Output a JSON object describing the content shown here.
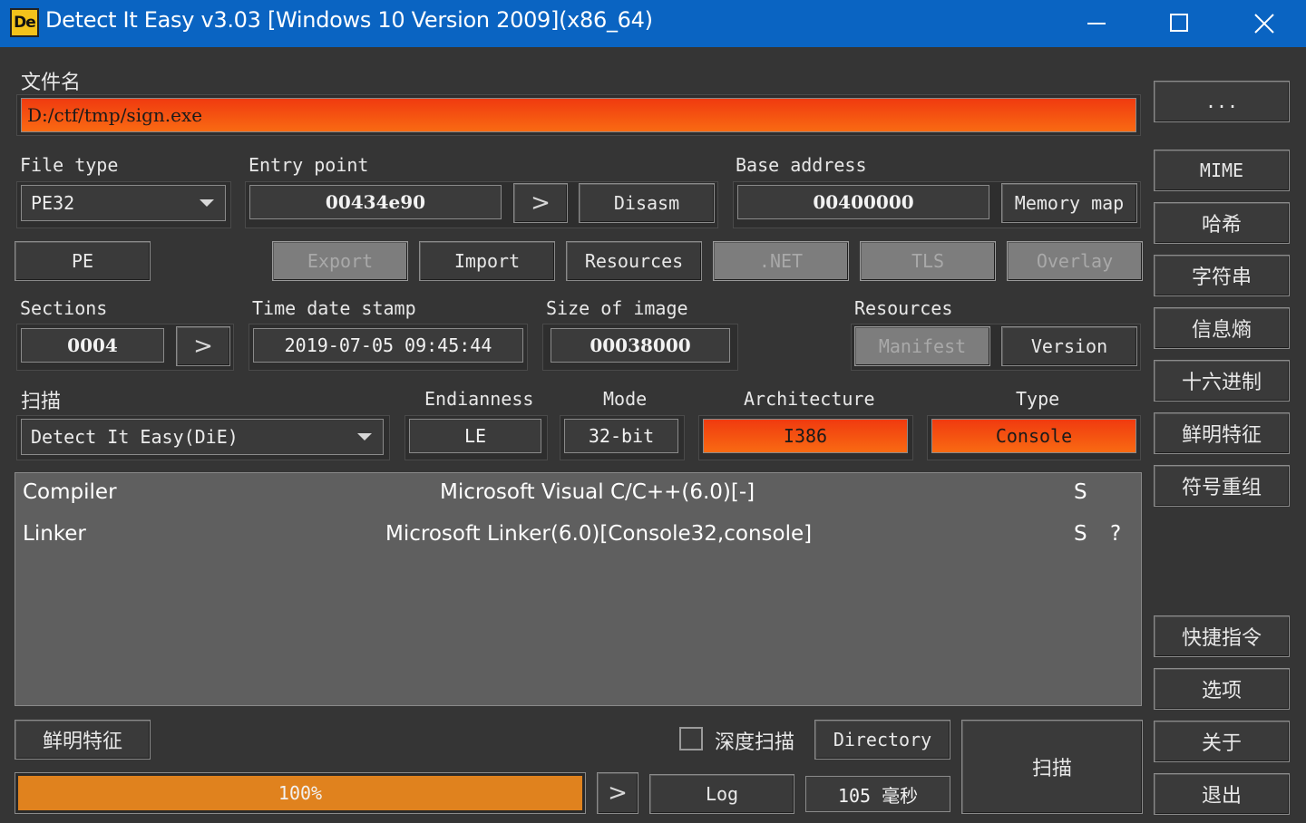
{
  "window": {
    "icon_text": "De",
    "title": "Detect It Easy v3.03 [Windows 10 Version 2009](x86_64)"
  },
  "file": {
    "label": "文件名",
    "path": "D:/ctf/tmp/sign.exe",
    "browse_label": "..."
  },
  "file_type": {
    "label": "File type",
    "value": "PE32"
  },
  "entry_point": {
    "label": "Entry point",
    "value": "00434e90",
    "go_label": ">",
    "disasm_label": "Disasm"
  },
  "base_address": {
    "label": "Base address",
    "value": "00400000",
    "memory_map_label": "Memory map"
  },
  "pe_buttons": {
    "pe": "PE",
    "export": "Export",
    "import": "Import",
    "resources": "Resources",
    "dotnet": ".NET",
    "tls": "TLS",
    "overlay": "Overlay"
  },
  "sections": {
    "label": "Sections",
    "value": "0004",
    "go_label": ">"
  },
  "time_date_stamp": {
    "label": "Time date stamp",
    "value": "2019-07-05 09:45:44"
  },
  "size_of_image": {
    "label": "Size of image",
    "value": "00038000"
  },
  "resources": {
    "label": "Resources",
    "manifest_label": "Manifest",
    "version_label": "Version"
  },
  "scan": {
    "label": "扫描",
    "engine": "Detect It Easy(DiE)",
    "endianness_label": "Endianness",
    "endianness": "LE",
    "mode_label": "Mode",
    "mode": "32-bit",
    "architecture_label": "Architecture",
    "architecture": "I386",
    "type_label": "Type",
    "type": "Console"
  },
  "results": [
    {
      "kind": "Compiler",
      "name": "Microsoft Visual C/C++(6.0)[-]",
      "flag": "S",
      "extra": ""
    },
    {
      "kind": "Linker",
      "name": "Microsoft Linker(6.0)[Console32,console]",
      "flag": "S",
      "extra": "?"
    }
  ],
  "bottom": {
    "signatures_label": "鲜明特征",
    "deep_scan_label": "深度扫描",
    "deep_scan_checked": false,
    "directory_label": "Directory",
    "scan_label": "扫描",
    "progress_text": "100%",
    "progress_value": 1.0,
    "go_label": ">",
    "log_label": "Log",
    "elapsed": "105 毫秒"
  },
  "sidebar": {
    "mime": "MIME",
    "hash": "哈希",
    "strings": "字符串",
    "entropy": "信息熵",
    "hex": "十六进制",
    "signatures": "鲜明特征",
    "demangle": "符号重组",
    "shortcuts": "快捷指令",
    "options": "选项",
    "about": "关于",
    "exit": "退出"
  },
  "colors": {
    "titlebar": "#0a64c2",
    "accent_hot": "#f03a10",
    "progress": "#e0821e",
    "background": "#353535"
  }
}
